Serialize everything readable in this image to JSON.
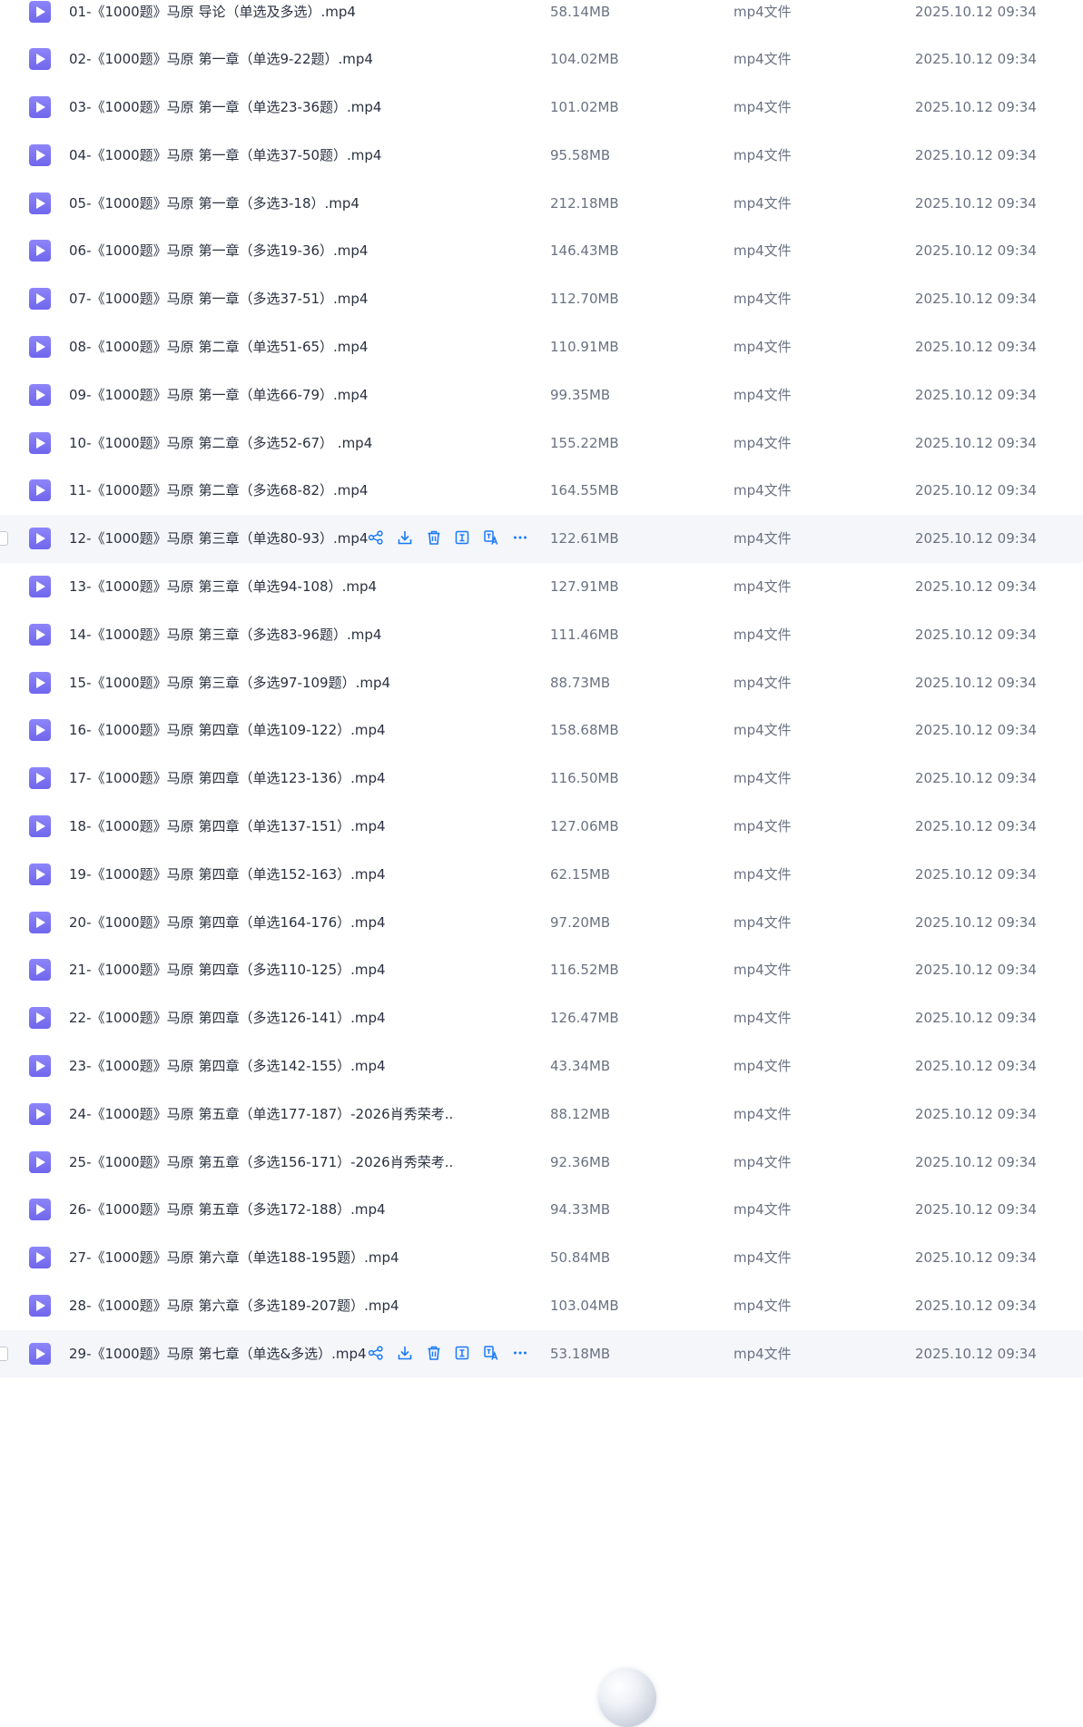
{
  "files": [
    {
      "name": "01-《1000题》马原 导论（单选及多选）.mp4",
      "size": "58.14MB",
      "type": "mp4文件",
      "date": "2025.10.12 09:34"
    },
    {
      "name": "02-《1000题》马原 第一章（单选9-22题）.mp4",
      "size": "104.02MB",
      "type": "mp4文件",
      "date": "2025.10.12 09:34"
    },
    {
      "name": "03-《1000题》马原 第一章（单选23-36题）.mp4",
      "size": "101.02MB",
      "type": "mp4文件",
      "date": "2025.10.12 09:34"
    },
    {
      "name": "04-《1000题》马原 第一章（单选37-50题）.mp4",
      "size": "95.58MB",
      "type": "mp4文件",
      "date": "2025.10.12 09:34"
    },
    {
      "name": "05-《1000题》马原 第一章（多选3-18）.mp4",
      "size": "212.18MB",
      "type": "mp4文件",
      "date": "2025.10.12 09:34"
    },
    {
      "name": "06-《1000题》马原 第一章（多选19-36）.mp4",
      "size": "146.43MB",
      "type": "mp4文件",
      "date": "2025.10.12 09:34"
    },
    {
      "name": "07-《1000题》马原 第一章（多选37-51）.mp4",
      "size": "112.70MB",
      "type": "mp4文件",
      "date": "2025.10.12 09:34"
    },
    {
      "name": "08-《1000题》马原 第二章（单选51-65）.mp4",
      "size": "110.91MB",
      "type": "mp4文件",
      "date": "2025.10.12 09:34"
    },
    {
      "name": "09-《1000题》马原 第一章（单选66-79）.mp4",
      "size": "99.35MB",
      "type": "mp4文件",
      "date": "2025.10.12 09:34"
    },
    {
      "name": "10-《1000题》马原 第二章（多选52-67） .mp4",
      "size": "155.22MB",
      "type": "mp4文件",
      "date": "2025.10.12 09:34"
    },
    {
      "name": "11-《1000题》马原 第二章（多选68-82）.mp4",
      "size": "164.55MB",
      "type": "mp4文件",
      "date": "2025.10.12 09:34"
    },
    {
      "name": "12-《1000题》马原 第三章（单选80-93）.mp4",
      "size": "122.61MB",
      "type": "mp4文件",
      "date": "2025.10.12 09:34",
      "hovered": true
    },
    {
      "name": "13-《1000题》马原 第三章（单选94-108）.mp4",
      "size": "127.91MB",
      "type": "mp4文件",
      "date": "2025.10.12 09:34"
    },
    {
      "name": "14-《1000题》马原 第三章（多选83-96题）.mp4",
      "size": "111.46MB",
      "type": "mp4文件",
      "date": "2025.10.12 09:34"
    },
    {
      "name": "15-《1000题》马原 第三章（多选97-109题）.mp4",
      "size": "88.73MB",
      "type": "mp4文件",
      "date": "2025.10.12 09:34"
    },
    {
      "name": "16-《1000题》马原 第四章（单选109-122）.mp4",
      "size": "158.68MB",
      "type": "mp4文件",
      "date": "2025.10.12 09:34"
    },
    {
      "name": "17-《1000题》马原 第四章（单选123-136）.mp4",
      "size": "116.50MB",
      "type": "mp4文件",
      "date": "2025.10.12 09:34"
    },
    {
      "name": "18-《1000题》马原 第四章（单选137-151）.mp4",
      "size": "127.06MB",
      "type": "mp4文件",
      "date": "2025.10.12 09:34"
    },
    {
      "name": "19-《1000题》马原 第四章（单选152-163）.mp4",
      "size": "62.15MB",
      "type": "mp4文件",
      "date": "2025.10.12 09:34"
    },
    {
      "name": "20-《1000题》马原 第四章（单选164-176）.mp4",
      "size": "97.20MB",
      "type": "mp4文件",
      "date": "2025.10.12 09:34"
    },
    {
      "name": "21-《1000题》马原 第四章（多选110-125）.mp4",
      "size": "116.52MB",
      "type": "mp4文件",
      "date": "2025.10.12 09:34"
    },
    {
      "name": "22-《1000题》马原 第四章（多选126-141）.mp4",
      "size": "126.47MB",
      "type": "mp4文件",
      "date": "2025.10.12 09:34"
    },
    {
      "name": "23-《1000题》马原 第四章（多选142-155）.mp4",
      "size": "43.34MB",
      "type": "mp4文件",
      "date": "2025.10.12 09:34"
    },
    {
      "name": "24-《1000题》马原 第五章（单选177-187）-2026肖秀荣考...",
      "size": "88.12MB",
      "type": "mp4文件",
      "date": "2025.10.12 09:34"
    },
    {
      "name": "25-《1000题》马原 第五章（多选156-171）-2026肖秀荣考...",
      "size": "92.36MB",
      "type": "mp4文件",
      "date": "2025.10.12 09:34"
    },
    {
      "name": "26-《1000题》马原 第五章（多选172-188）.mp4",
      "size": "94.33MB",
      "type": "mp4文件",
      "date": "2025.10.12 09:34"
    },
    {
      "name": "27-《1000题》马原 第六章（单选188-195题）.mp4",
      "size": "50.84MB",
      "type": "mp4文件",
      "date": "2025.10.12 09:34"
    },
    {
      "name": "28-《1000题》马原 第六章（多选189-207题）.mp4",
      "size": "103.04MB",
      "type": "mp4文件",
      "date": "2025.10.12 09:34"
    },
    {
      "name": "29-《1000题》马原 第七章（单选&多选）.mp4",
      "size": "53.18MB",
      "type": "mp4文件",
      "date": "2025.10.12 09:34",
      "hovered": true
    }
  ],
  "row_actions": [
    "share-icon",
    "download-icon",
    "delete-icon",
    "text-extract-icon",
    "translate-icon",
    "more-icon"
  ],
  "colors": {
    "accent": "#1a7af8",
    "file_icon": "#7a72f2",
    "hover_row_bg": "#f5f6fa"
  }
}
